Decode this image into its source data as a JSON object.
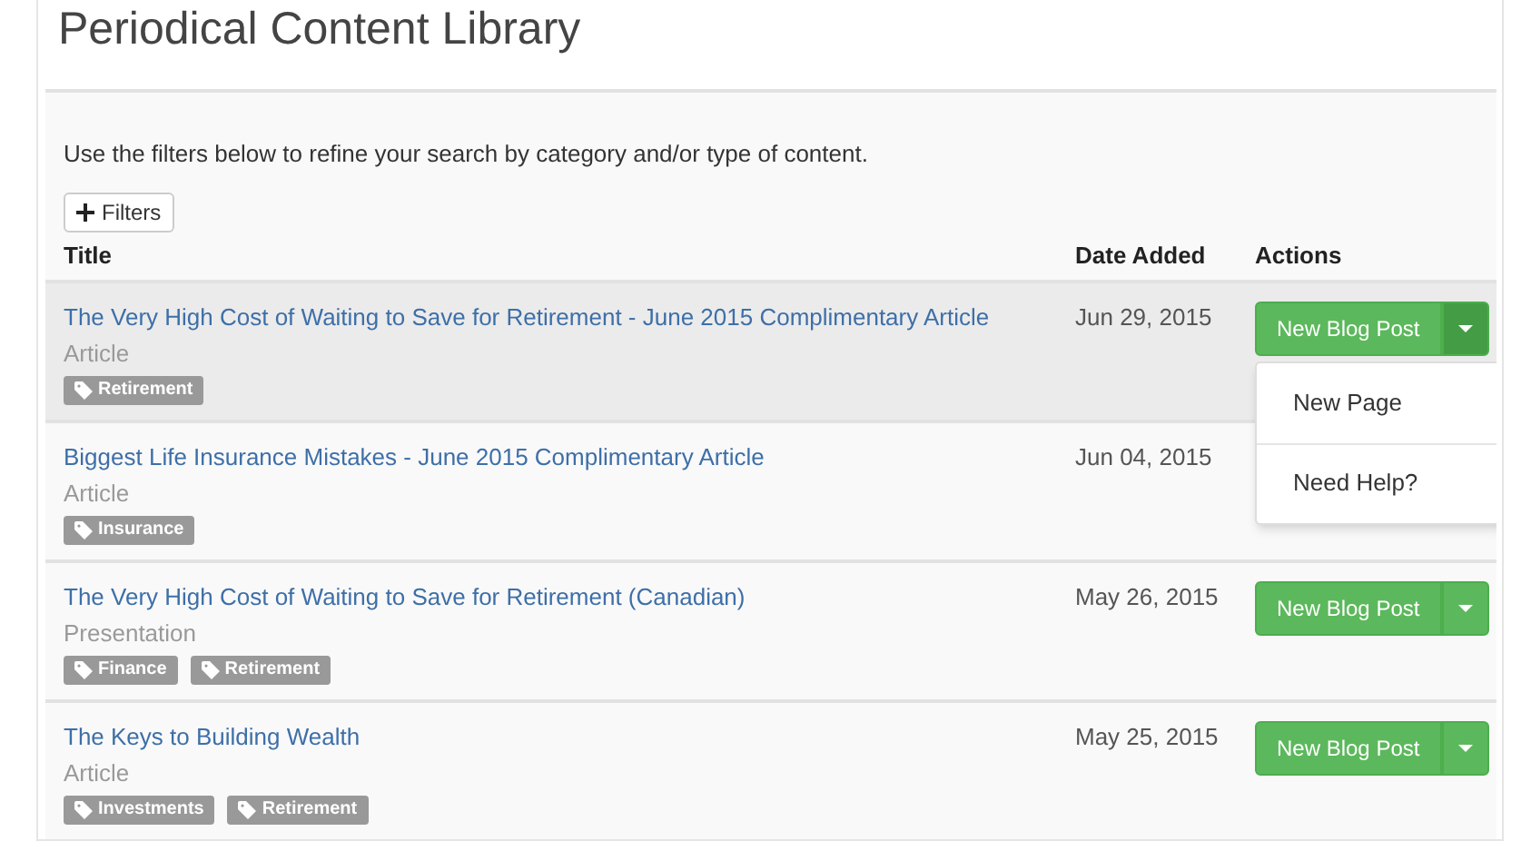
{
  "page_title": "Periodical Content Library",
  "intro": "Use the filters below to refine your search by category and/or type of content.",
  "filters_button": "Filters",
  "table": {
    "columns": [
      "Title",
      "Date Added",
      "Actions"
    ],
    "rows": [
      {
        "title": "The Very High Cost of Waiting to Save for Retirement - June 2015 Complimentary Article",
        "type": "Article",
        "tags": [
          "Retirement"
        ],
        "date": "Jun 29, 2015",
        "action": "New Blog Post",
        "highlighted": true,
        "menu_open": true,
        "menu": [
          "New Page",
          "Need Help?"
        ]
      },
      {
        "title": "Biggest Life Insurance Mistakes - June 2015 Complimentary Article",
        "type": "Article",
        "tags": [
          "Insurance"
        ],
        "date": "Jun 04, 2015",
        "highlighted": false,
        "menu_open": false
      },
      {
        "title": "The Very High Cost of Waiting to Save for Retirement (Canadian)",
        "type": "Presentation",
        "tags": [
          "Finance",
          "Retirement"
        ],
        "date": "May 26, 2015",
        "action": "New Blog Post",
        "highlighted": false,
        "menu_open": false
      },
      {
        "title": "The Keys to Building Wealth",
        "type": "Article",
        "tags": [
          "Investments",
          "Retirement"
        ],
        "date": "May 25, 2015",
        "action": "New Blog Post",
        "highlighted": false,
        "menu_open": false
      }
    ]
  }
}
